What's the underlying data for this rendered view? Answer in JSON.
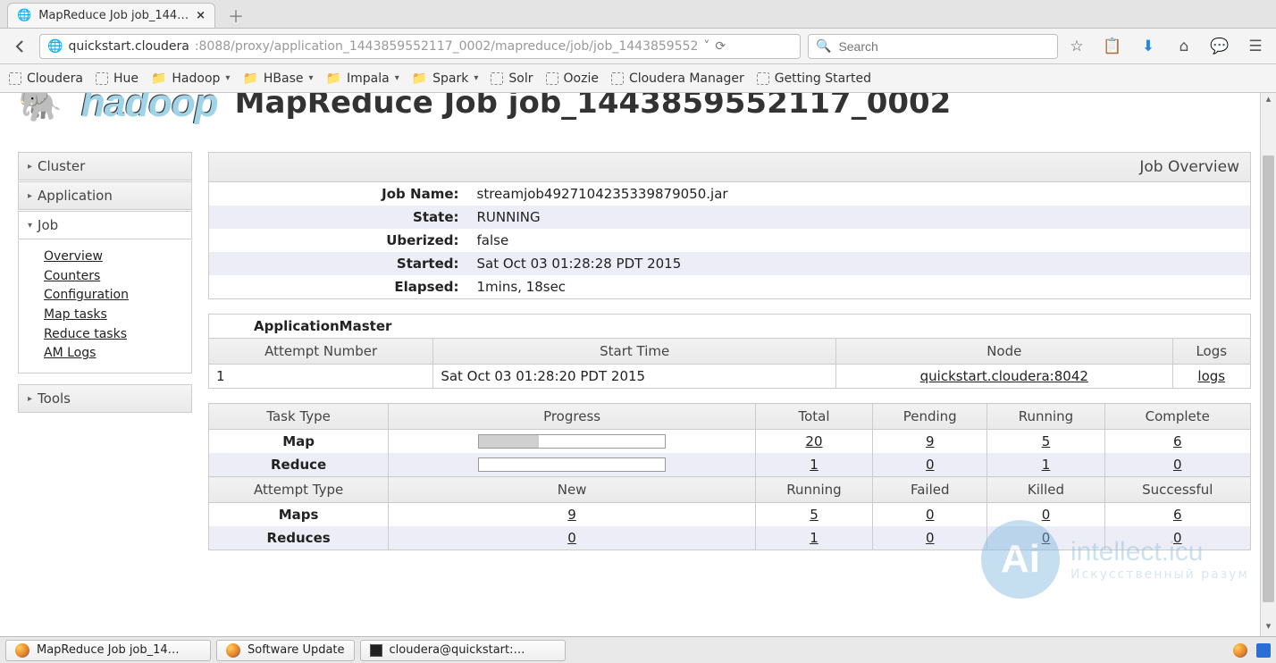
{
  "browser": {
    "tab_title": "MapReduce Job job_144…",
    "url_host": "quickstart.cloudera",
    "url_path": ":8088/proxy/application_1443859552117_0002/mapreduce/job/job_1443859552",
    "search_placeholder": "Search"
  },
  "bookmarks": {
    "items": [
      {
        "label": "Cloudera",
        "type": "plain"
      },
      {
        "label": "Hue",
        "type": "plain"
      },
      {
        "label": "Hadoop",
        "type": "folder",
        "dropdown": true
      },
      {
        "label": "HBase",
        "type": "folder",
        "dropdown": true
      },
      {
        "label": "Impala",
        "type": "folder",
        "dropdown": true
      },
      {
        "label": "Spark",
        "type": "folder",
        "dropdown": true
      },
      {
        "label": "Solr",
        "type": "plain"
      },
      {
        "label": "Oozie",
        "type": "plain"
      },
      {
        "label": "Cloudera Manager",
        "type": "plain"
      },
      {
        "label": "Getting Started",
        "type": "plain"
      }
    ]
  },
  "page": {
    "logo_text": "hadoop",
    "title": "MapReduce Job job_1443859552117_0002"
  },
  "sidebar": {
    "sections": {
      "cluster": "Cluster",
      "application": "Application",
      "job": "Job",
      "tools": "Tools"
    },
    "job_links": [
      "Overview",
      "Counters",
      "Configuration",
      "Map tasks",
      "Reduce tasks",
      "AM Logs"
    ]
  },
  "overview": {
    "heading": "Job Overview",
    "rows": [
      {
        "k": "Job Name:",
        "v": "streamjob4927104235339879050.jar"
      },
      {
        "k": "State:",
        "v": "RUNNING"
      },
      {
        "k": "Uberized:",
        "v": "false"
      },
      {
        "k": "Started:",
        "v": "Sat Oct 03 01:28:28 PDT 2015"
      },
      {
        "k": "Elapsed:",
        "v": "1mins, 18sec"
      }
    ]
  },
  "am": {
    "title": "ApplicationMaster",
    "headers": [
      "Attempt Number",
      "Start Time",
      "Node",
      "Logs"
    ],
    "row": {
      "attempt": "1",
      "start": "Sat Oct 03 01:28:20 PDT 2015",
      "node": "quickstart.cloudera:8042",
      "logs": "logs"
    }
  },
  "tasks": {
    "headers": [
      "Task Type",
      "Progress",
      "Total",
      "Pending",
      "Running",
      "Complete"
    ],
    "map": {
      "label": "Map",
      "progress_pct": 32,
      "total": "20",
      "pending": "9",
      "running": "5",
      "complete": "6"
    },
    "reduce": {
      "label": "Reduce",
      "progress_pct": 0,
      "total": "1",
      "pending": "0",
      "running": "1",
      "complete": "0"
    }
  },
  "attempts": {
    "headers": [
      "Attempt Type",
      "New",
      "Running",
      "Failed",
      "Killed",
      "Successful"
    ],
    "maps": {
      "label": "Maps",
      "new": "9",
      "running": "5",
      "failed": "0",
      "killed": "0",
      "successful": "6"
    },
    "reduces": {
      "label": "Reduces",
      "new": "0",
      "running": "1",
      "failed": "0",
      "killed": "0",
      "successful": "0"
    }
  },
  "taskbar": {
    "btn1": "MapReduce Job job_14…",
    "btn2": "Software Update",
    "btn3": "cloudera@quickstart:…"
  },
  "watermark": {
    "brand": "intellect.icu",
    "sub": "Искусственный разум",
    "badge": "Ai"
  }
}
